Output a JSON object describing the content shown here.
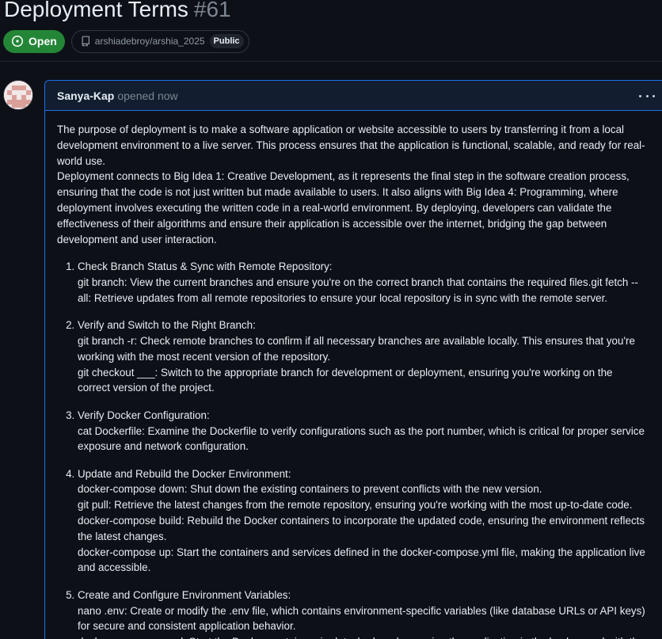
{
  "issue": {
    "title": "Deployment Terms",
    "number": "#61",
    "state": "Open",
    "repo": "arshiadebroy/arshia_2025",
    "visibility": "Public"
  },
  "comment": {
    "author": "Sanya-Kap",
    "opened": "opened now",
    "intro_1": "The purpose of deployment is to make a software application or website accessible to users by transferring it from a local development environment to a live server. This process ensures that the application is functional, scalable, and ready for real-world use.",
    "intro_2": "Deployment connects to Big Idea 1: Creative Development, as it represents the final step in the software creation process, ensuring that the code is not just written but made available to users. It also aligns with Big Idea 4: Programming, where deployment involves executing the written code in a real-world environment. By deploying, developers can validate the effectiveness of their algorithms and ensure their application is accessible over the internet, bridging the gap between development and user interaction.",
    "steps": [
      {
        "heading": "Check Branch Status & Sync with Remote Repository:",
        "lines": [
          "git branch: View the current branches and ensure you're on the correct branch that contains the required files.git fetch --all: Retrieve updates from all remote repositories to ensure your local repository is in sync with the remote server."
        ]
      },
      {
        "heading": "Verify and Switch to the Right Branch:",
        "lines": [
          "git branch -r: Check remote branches to confirm if all necessary branches are available locally. This ensures that you're working with the most recent version of the repository.",
          "git checkout ___: Switch to the appropriate branch for development or deployment, ensuring you're working on the correct version of the project."
        ]
      },
      {
        "heading": "Verify Docker Configuration:",
        "lines": [
          "cat Dockerfile: Examine the Dockerfile to verify configurations such as the port number, which is critical for proper service exposure and network configuration."
        ]
      },
      {
        "heading": "Update and Rebuild the Docker Environment:",
        "lines": [
          "docker-compose down: Shut down the existing containers to prevent conflicts with the new version.",
          "git pull: Retrieve the latest changes from the remote repository, ensuring you're working with the most up-to-date code.",
          "docker-compose build: Rebuild the Docker containers to incorporate the updated code, ensuring the environment reflects the latest changes.",
          "docker-compose up: Start the containers and services defined in the docker-compose.yml file, making the application live and accessible."
        ]
      },
      {
        "heading": "Create and Configure Environment Variables:",
        "lines": [
          "nano .env: Create or modify the .env file, which contains environment-specific variables (like database URLs or API keys) for secure and consistent application behavior.",
          "docker-compose up -d: Start the Docker containers in detached mode, running the application in the background with the"
        ]
      }
    ]
  },
  "colors": {
    "open_green": "#238636",
    "focus_blue": "#1f6feb",
    "background": "#0d1117"
  },
  "icons": {
    "state": "issue-opened-icon",
    "repo": "repo-icon",
    "menu": "kebab-horizontal-icon"
  }
}
